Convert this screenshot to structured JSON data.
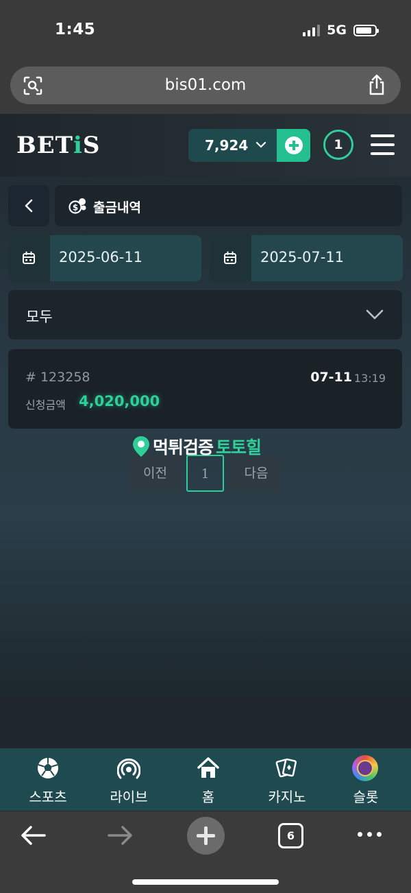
{
  "status_bar": {
    "time": "1:45",
    "network": "5G"
  },
  "browser": {
    "url": "bis01.com",
    "tab_count": "6"
  },
  "header": {
    "logo_text_part1": "BET",
    "logo_text_accent": "i",
    "logo_text_part2": "S",
    "balance": "7,924",
    "notification_count": "1",
    "accent_color": "#2fcf9a"
  },
  "page": {
    "title": "출금내역",
    "date_from": "2025-06-11",
    "date_to": "2025-07-11",
    "filter_value": "모두"
  },
  "records": [
    {
      "id": "# 123258",
      "date": "07-11",
      "time": "13:19",
      "amount_label": "신청금액",
      "amount": "4,020,000"
    }
  ],
  "watermark": {
    "text_part1": "먹튀검증",
    "text_part2": "토토힐"
  },
  "pagination": {
    "prev_label": "이전",
    "current_page": "1",
    "next_label": "다음"
  },
  "bottom_nav": {
    "items": [
      {
        "label": "스포츠",
        "icon": "soccer-ball-icon"
      },
      {
        "label": "라이브",
        "icon": "broadcast-icon"
      },
      {
        "label": "홈",
        "icon": "home-icon"
      },
      {
        "label": "카지노",
        "icon": "cards-icon"
      },
      {
        "label": "슬롯",
        "icon": "slot-icon"
      }
    ]
  }
}
